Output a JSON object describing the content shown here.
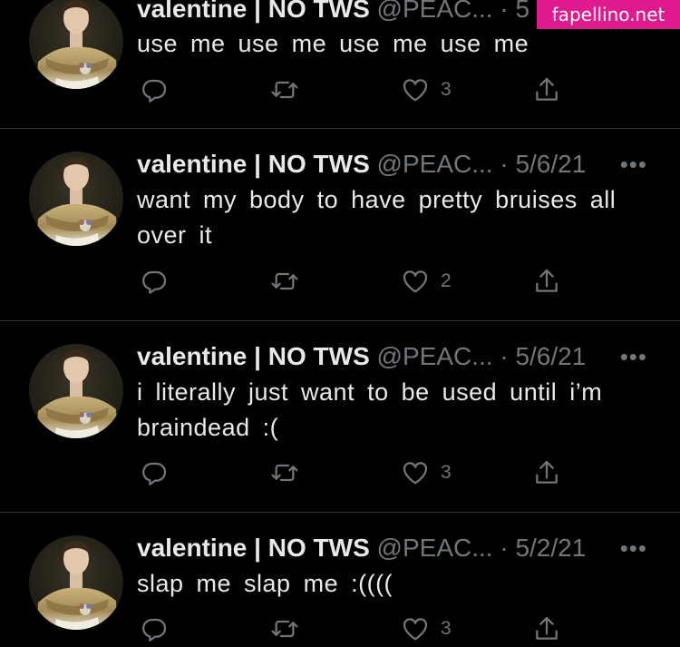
{
  "watermark": "fapellino.net",
  "tweets": [
    {
      "name": "valentine | NO TWS",
      "handle": "@PEAC...",
      "dot": "·",
      "date": "5",
      "more": "•••",
      "text": "use me  use me  use me  use me",
      "replies": "",
      "retweets": "",
      "likes": "3"
    },
    {
      "name": "valentine | NO TWS",
      "handle": "@PEAC...",
      "dot": "·",
      "date": "5/6/21",
      "more": "•••",
      "text": "want my body to have pretty bruises all over it",
      "replies": "",
      "retweets": "",
      "likes": "2"
    },
    {
      "name": "valentine | NO TWS",
      "handle": "@PEAC...",
      "dot": "·",
      "date": "5/6/21",
      "more": "•••",
      "text": "i literally just want to be used until i’m braindead :(",
      "replies": "",
      "retweets": "",
      "likes": "3"
    },
    {
      "name": "valentine | NO TWS",
      "handle": "@PEAC...",
      "dot": "·",
      "date": "5/2/21",
      "more": "•••",
      "text": "slap me slap me :((((",
      "replies": "",
      "retweets": "",
      "likes": "3"
    }
  ],
  "icons": {
    "reply": "reply-icon",
    "retweet": "retweet-icon",
    "like": "heart-icon",
    "share": "share-icon",
    "more": "more-icon"
  },
  "colors": {
    "background": "#000000",
    "text": "#e7e9ea",
    "muted": "#71767b",
    "divider": "#2f3336",
    "watermark": "#e0198c"
  }
}
